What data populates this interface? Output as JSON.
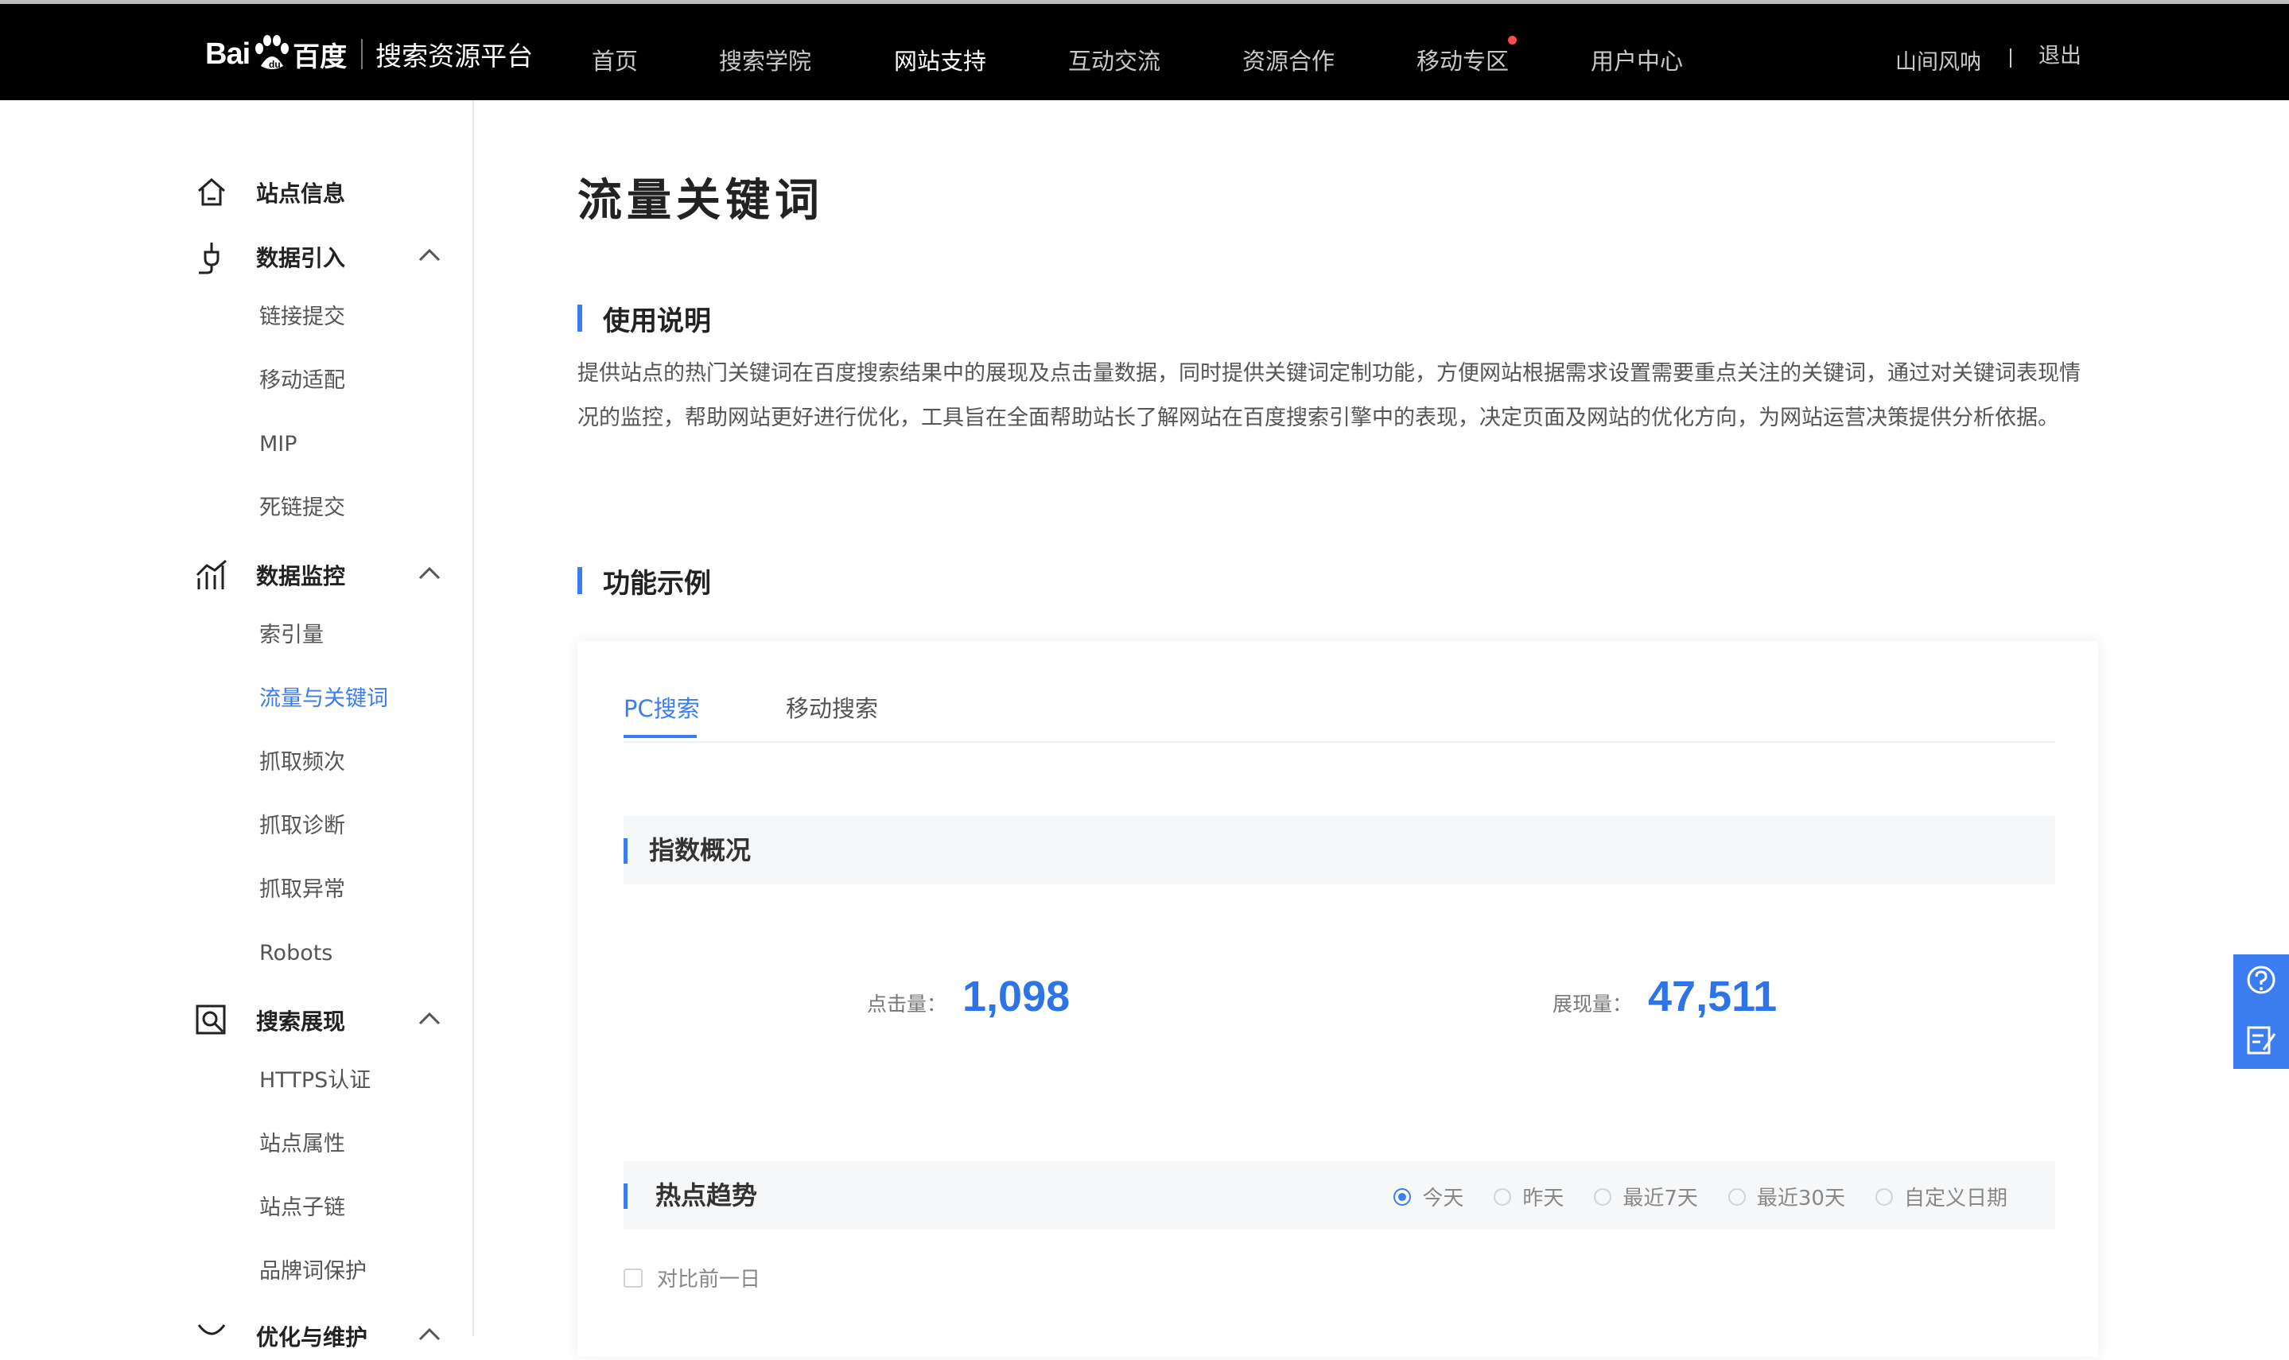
{
  "header": {
    "logo_text_bai": "Bai",
    "logo_text_du": "百度",
    "platform": "搜索资源平台",
    "nav": [
      "首页",
      "搜索学院",
      "网站支持",
      "互动交流",
      "资源合作",
      "移动专区",
      "用户中心"
    ],
    "active_nav": "网站支持",
    "user_name": "山间风呐",
    "logout": "退出"
  },
  "sidebar": {
    "site_info": "站点信息",
    "data_import": {
      "label": "数据引入",
      "items": [
        "链接提交",
        "移动适配",
        "MIP",
        "死链提交"
      ]
    },
    "data_monitor": {
      "label": "数据监控",
      "items": [
        "索引量",
        "流量与关键词",
        "抓取频次",
        "抓取诊断",
        "抓取异常",
        "Robots"
      ]
    },
    "search_display": {
      "label": "搜索展现",
      "items": [
        "HTTPS认证",
        "站点属性",
        "站点子链",
        "品牌词保护"
      ]
    },
    "optimize": {
      "label": "优化与维护"
    }
  },
  "main": {
    "title": "流量关键词",
    "usage_title": "使用说明",
    "usage_desc": "提供站点的热门关键词在百度搜索结果中的展现及点击量数据，同时提供关键词定制功能，方便网站根据需求设置需要重点关注的关键词，通过对关键词表现情况的监控，帮助网站更好进行优化，工具旨在全面帮助站长了解网站在百度搜索引擎中的表现，决定页面及网站的优化方向，为网站运营决策提供分析依据。",
    "example_title": "功能示例",
    "tabs": {
      "pc": "PC搜索",
      "mobile": "移动搜索"
    },
    "overview_title": "指数概况",
    "clicks_label": "点击量：",
    "clicks_value": "1,098",
    "impressions_label": "展现量：",
    "impressions_value": "47,511",
    "trend_title": "热点趋势",
    "ranges": [
      "今天",
      "昨天",
      "最近7天",
      "最近30天",
      "自定义日期"
    ],
    "compare_label": "对比前一日"
  },
  "colors": {
    "accent": "#3b7cf0",
    "nav_bg": "#000000"
  }
}
